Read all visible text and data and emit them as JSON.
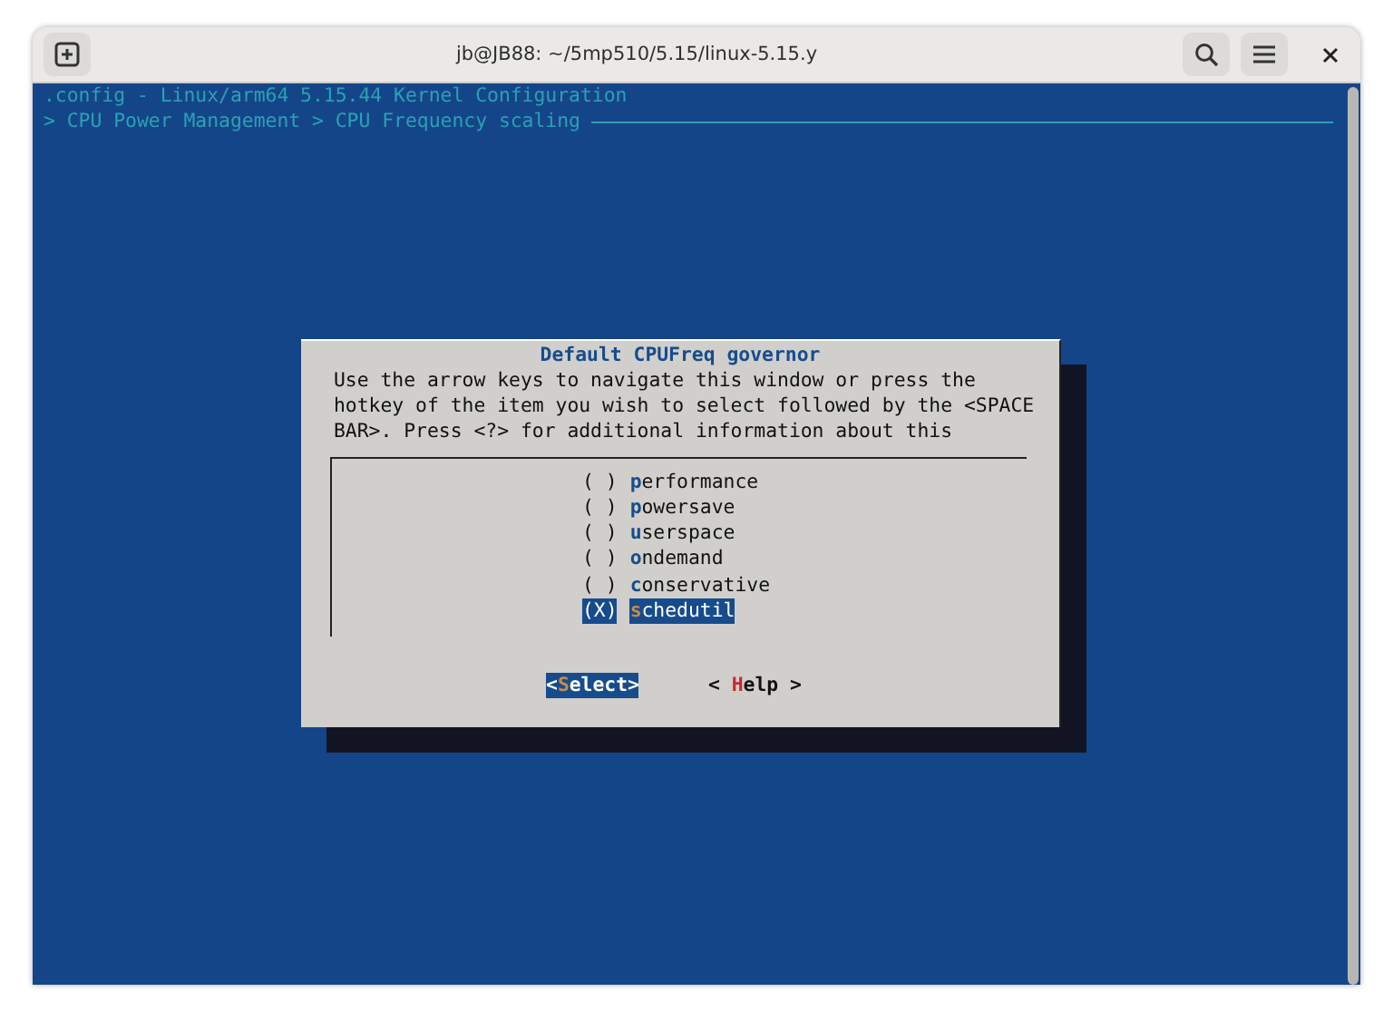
{
  "window": {
    "title": "jb@JB88: ~/5mp510/5.15/linux-5.15.y"
  },
  "terminal": {
    "header": ".config - Linux/arm64 5.15.44 Kernel Configuration",
    "breadcrumb": "> CPU Power Management > CPU Frequency scaling"
  },
  "dialog": {
    "title": "Default CPUFreq governor",
    "help_lines": [
      "Use the arrow keys to navigate this window or press the",
      "hotkey of the item you wish to select followed by the <SPACE",
      "BAR>. Press <?> for additional information about this"
    ],
    "items": [
      {
        "marker": "( )",
        "key": "p",
        "rest": "erformance",
        "selected": false
      },
      {
        "marker": "( )",
        "key": "p",
        "rest": "owersave",
        "selected": false
      },
      {
        "marker": "( )",
        "key": "u",
        "rest": "serspace",
        "selected": false
      },
      {
        "marker": "( )",
        "key": "o",
        "rest": "ndemand",
        "selected": false
      },
      {
        "marker": "( )",
        "key": "c",
        "rest": "onservative",
        "selected": false
      },
      {
        "marker": "(X)",
        "key": "s",
        "rest": "chedutil",
        "selected": true
      }
    ],
    "buttons": [
      {
        "before": "<",
        "key": "S",
        "after": "elect>",
        "selected": true
      },
      {
        "before": "< ",
        "key": "H",
        "after": "elp >",
        "selected": false
      }
    ]
  }
}
